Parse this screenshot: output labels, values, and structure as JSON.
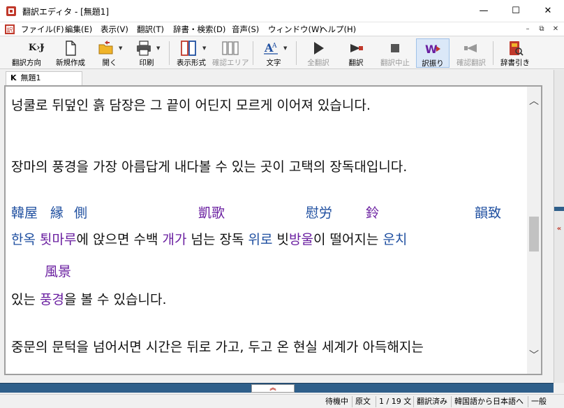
{
  "window": {
    "title": "翻訳エディタ - [無題1]",
    "controls": {
      "minimize": "—",
      "maximize": "☐",
      "close": "✕"
    }
  },
  "menu": {
    "items": [
      "ファイル(F)",
      "編集(E)",
      "表示(V)",
      "翻訳(T)",
      "辞書・検索(D)",
      "音声(S)",
      "ウィンドウ(W)",
      "ヘルプ(H)"
    ],
    "mdi": {
      "minimize": "–",
      "restore": "⧉",
      "close": "✕"
    }
  },
  "toolbar": {
    "buttons": [
      {
        "label": "翻訳方向",
        "icon": "kj-direction-icon",
        "icon_text": "K›J"
      },
      {
        "label": "新規作成",
        "icon": "new-document-icon"
      },
      {
        "label": "開く",
        "icon": "open-folder-icon"
      },
      {
        "label": "印刷",
        "icon": "printer-icon"
      },
      {
        "label": "表示形式",
        "icon": "display-format-icon"
      },
      {
        "label": "確認エリア",
        "icon": "confirm-area-icon",
        "disabled": true
      },
      {
        "label": "文字",
        "icon": "text-size-icon"
      },
      {
        "label": "全翻訳",
        "icon": "translate-all-icon",
        "disabled": true
      },
      {
        "label": "翻訳",
        "icon": "translate-icon"
      },
      {
        "label": "翻訳中止",
        "icon": "stop-translation-icon",
        "disabled": true
      },
      {
        "label": "訳振り",
        "icon": "ruby-translation-icon",
        "active": true
      },
      {
        "label": "確認翻訳",
        "icon": "confirm-translation-icon",
        "disabled": true
      },
      {
        "label": "辞書引き",
        "icon": "dictionary-lookup-icon"
      }
    ]
  },
  "tab": {
    "prefix": "K",
    "name": "無題1"
  },
  "editor": {
    "line1": "넝쿨로 뒤덮인 흙 담장은 그 끝이 어딘지 모르게 이어져 있습니다.",
    "line2": "장마의 풍경을 가장 아름답게 내다볼 수 있는 곳이 고택의 장독대입니다.",
    "ruby": [
      {
        "text": "韓屋",
        "color": "blue"
      },
      {
        "text": "縁",
        "color": "blue"
      },
      {
        "text": "側",
        "color": "blue"
      },
      {
        "text": "凱歌",
        "color": "purple"
      },
      {
        "text": "慰労",
        "color": "blue"
      },
      {
        "text": "鈴",
        "color": "purple"
      },
      {
        "text": "韻致",
        "color": "blue"
      }
    ],
    "line3_segments": [
      {
        "text": "한옥",
        "color": "blue"
      },
      {
        "text": " ",
        "color": ""
      },
      {
        "text": "툇마루",
        "color": "purple"
      },
      {
        "text": "에 앉으면 수백 ",
        "color": ""
      },
      {
        "text": "개가",
        "color": "purple"
      },
      {
        "text": " 넘는 장독 ",
        "color": ""
      },
      {
        "text": "위로",
        "color": "blue"
      },
      {
        "text": " 빗",
        "color": ""
      },
      {
        "text": "방울",
        "color": "purple"
      },
      {
        "text": "이 떨어지는 ",
        "color": ""
      },
      {
        "text": "운치",
        "color": "blue"
      }
    ],
    "ruby2": {
      "text": "風景",
      "color": "purple"
    },
    "line4_segments": [
      {
        "text": "있는 ",
        "color": ""
      },
      {
        "text": "풍경",
        "color": "purple"
      },
      {
        "text": "을 볼 수 있습니다.",
        "color": ""
      }
    ],
    "line5": "중문의 문턱을 넘어서면 시간은 뒤로 가고, 두고 온 현실 세계가 아득해지는"
  },
  "statusbar": {
    "cells": [
      "待機中",
      "原文",
      "1 / 19 文",
      "翻訳済み",
      "韓国語から日本語へ",
      "一般"
    ]
  },
  "colors": {
    "blue": "#1f4fa0",
    "purple": "#6a1fa0",
    "accent": "#2f5f8a"
  }
}
